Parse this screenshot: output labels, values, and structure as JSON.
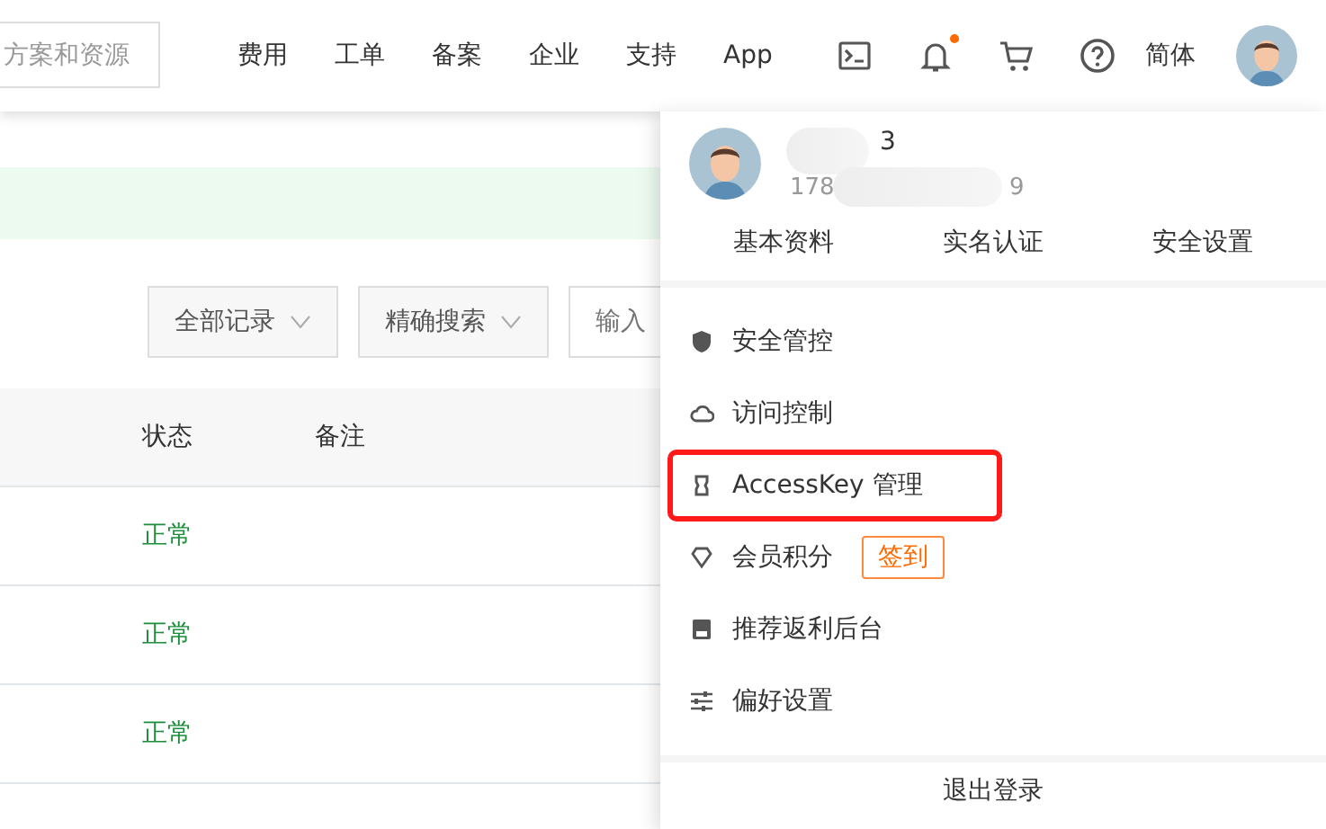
{
  "search": {
    "placeholder": "方案和资源"
  },
  "nav": [
    {
      "label": "费用"
    },
    {
      "label": "工单"
    },
    {
      "label": "备案"
    },
    {
      "label": "企业"
    },
    {
      "label": "支持"
    },
    {
      "label": "App"
    }
  ],
  "nav_icons": [
    {
      "kind": "terminal"
    },
    {
      "kind": "bell",
      "dot": true
    },
    {
      "kind": "cart"
    },
    {
      "kind": "help"
    }
  ],
  "language": "简体",
  "filters": [
    {
      "kind": "select",
      "label": "全部记录"
    },
    {
      "kind": "select",
      "label": "精确搜索"
    },
    {
      "kind": "input",
      "placeholder": "输入"
    }
  ],
  "table": {
    "columns": [
      "状态",
      "备注"
    ],
    "rows": [
      {
        "status": "正常"
      },
      {
        "status": "正常"
      },
      {
        "status": "正常"
      }
    ]
  },
  "account_menu": {
    "user": {
      "name_visible": "3",
      "phone_visible_start": "178",
      "phone_visible_end": "9"
    },
    "tabs": [
      {
        "label": "基本资料"
      },
      {
        "label": "实名认证"
      },
      {
        "label": "安全设置"
      }
    ],
    "items": [
      {
        "label": "安全管控",
        "highlighted": false
      },
      {
        "label": "访问控制",
        "highlighted": false
      },
      {
        "label": "AccessKey 管理",
        "highlighted": true
      },
      {
        "label": "会员积分",
        "highlighted": false,
        "action": "签到"
      },
      {
        "label": "推荐返利后台",
        "highlighted": false
      },
      {
        "label": "偏好设置",
        "highlighted": false
      }
    ],
    "logout": "退出登录"
  }
}
